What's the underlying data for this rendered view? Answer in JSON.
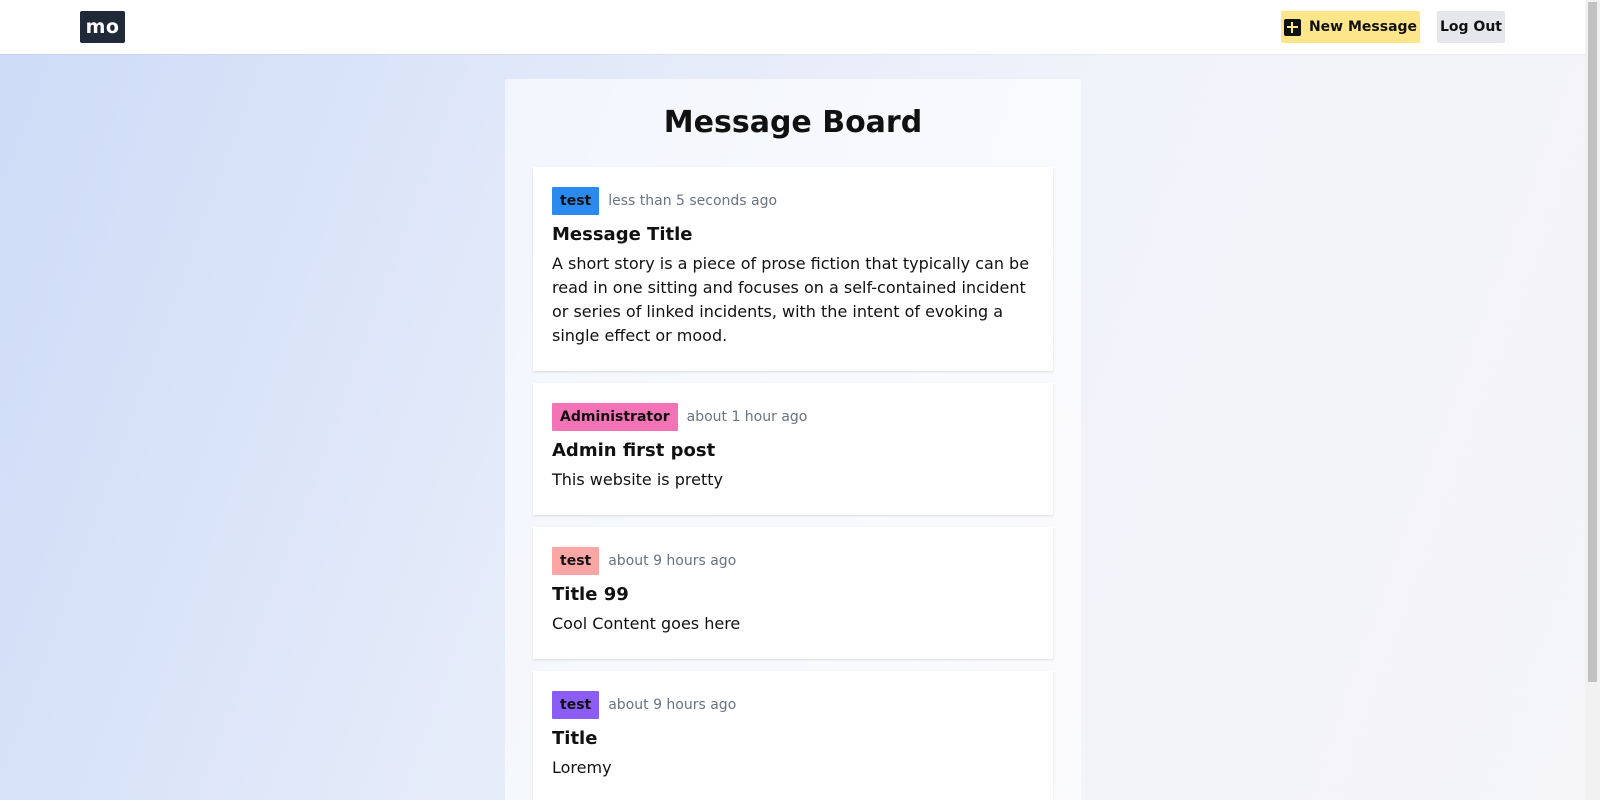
{
  "header": {
    "logo": "mo",
    "new_message_label": "New Message",
    "logout_label": "Log Out"
  },
  "board": {
    "title": "Message Board"
  },
  "messages": [
    {
      "tag": "test",
      "tag_color": "#2b8af0",
      "time": "less than 5 seconds ago",
      "title": "Message Title",
      "body": "A short story is a piece of prose fiction that typically can be read in one sitting and focuses on a self-contained incident or series of linked incidents, with the intent of evoking a single effect or mood."
    },
    {
      "tag": "Administrator",
      "tag_color": "#f472b6",
      "time": "about 1 hour ago",
      "title": "Admin first post",
      "body": "This website is pretty"
    },
    {
      "tag": "test",
      "tag_color": "#fca5a5",
      "time": "about 9 hours ago",
      "title": "Title 99",
      "body": "Cool Content goes here"
    },
    {
      "tag": "test",
      "tag_color": "#8b5cf6",
      "time": "about 9 hours ago",
      "title": "Title",
      "body": "Loremy"
    }
  ]
}
